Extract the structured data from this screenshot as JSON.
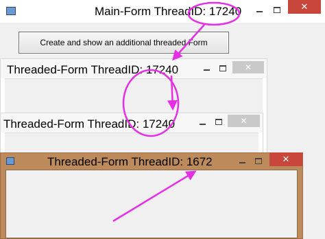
{
  "main_form": {
    "title": "Main-Form ThreadID: 17240",
    "button_label": "Create and show an additional threaded Form",
    "close_glyph": "✕"
  },
  "threaded_forms": [
    {
      "title": "Threaded-Form ThreadID: 17240",
      "close_glyph": "✕"
    },
    {
      "title": "Threaded-Form ThreadID: 17240",
      "close_glyph": "✕"
    },
    {
      "title": "Threaded-Form ThreadID: 1672",
      "close_glyph": "✕"
    }
  ],
  "colors": {
    "annotation": "#e52ee5",
    "close_hover_red": "#c9463c",
    "active_frame": "#bd8a5c"
  },
  "icons": [
    "app-form-icon",
    "minimize-icon",
    "maximize-icon",
    "close-icon"
  ]
}
